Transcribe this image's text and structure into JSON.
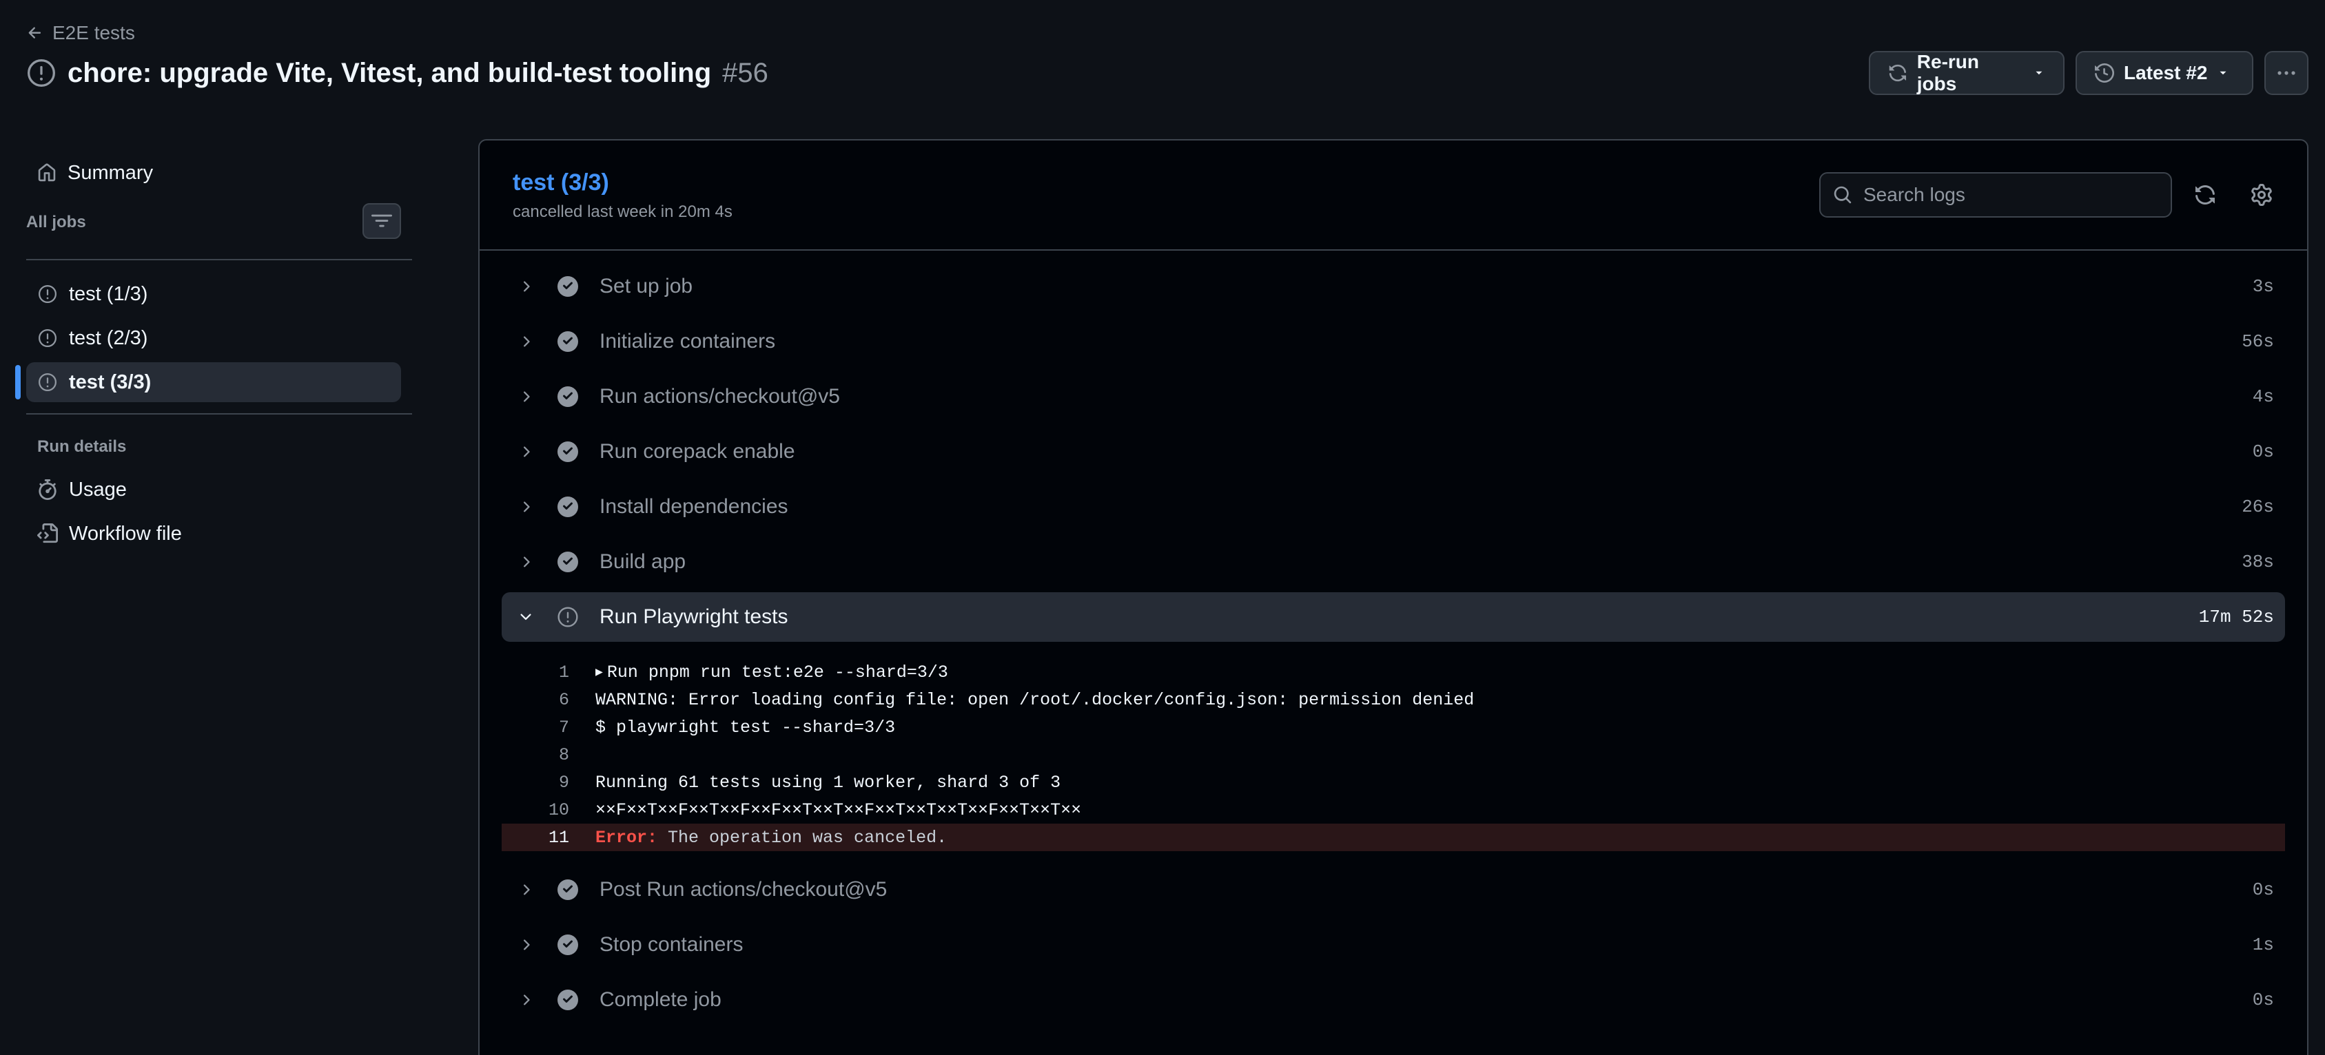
{
  "header": {
    "back_label": "E2E tests",
    "title": "chore: upgrade Vite, Vitest, and build-test tooling",
    "run_number": "#56",
    "rerun_label": "Re-run jobs",
    "attempt_label": "Latest #2"
  },
  "sidebar": {
    "summary_label": "Summary",
    "all_jobs_label": "All jobs",
    "jobs": [
      {
        "label": "test (1/3)"
      },
      {
        "label": "test (2/3)"
      },
      {
        "label": "test (3/3)",
        "active": true
      }
    ],
    "run_details_label": "Run details",
    "usage_label": "Usage",
    "workflow_file_label": "Workflow file"
  },
  "job": {
    "title": "test (3/3)",
    "subtitle": "cancelled last week in 20m 4s",
    "search_placeholder": "Search logs"
  },
  "steps": [
    {
      "name": "Set up job",
      "duration": "3s",
      "status": "success"
    },
    {
      "name": "Initialize containers",
      "duration": "56s",
      "status": "success"
    },
    {
      "name": "Run actions/checkout@v5",
      "duration": "4s",
      "status": "success"
    },
    {
      "name": "Run corepack enable",
      "duration": "0s",
      "status": "success"
    },
    {
      "name": "Install dependencies",
      "duration": "26s",
      "status": "success"
    },
    {
      "name": "Build app",
      "duration": "38s",
      "status": "success"
    },
    {
      "name": "Run Playwright tests",
      "duration": "17m 52s",
      "status": "cancelled",
      "expanded": true
    },
    {
      "name": "Post Run actions/checkout@v5",
      "duration": "0s",
      "status": "success"
    },
    {
      "name": "Stop containers",
      "duration": "1s",
      "status": "success"
    },
    {
      "name": "Complete job",
      "duration": "0s",
      "status": "success"
    }
  ],
  "log": [
    {
      "num": "1",
      "text": "Run pnpm run test:e2e --shard=3/3"
    },
    {
      "num": "6",
      "text": "WARNING: Error loading config file: open /root/.docker/config.json: permission denied"
    },
    {
      "num": "7",
      "text": "$ playwright test --shard=3/3"
    },
    {
      "num": "8",
      "text": ""
    },
    {
      "num": "9",
      "text": "Running 61 tests using 1 worker, shard 3 of 3"
    },
    {
      "num": "10",
      "text": "××F××T××F××T××F××F××T××T××F××T××T××T××F××T××T××"
    },
    {
      "num": "11",
      "error_label": "Error:",
      "text": "The operation was canceled."
    }
  ],
  "colors": {
    "background": "#0d1117",
    "panel": "#010409",
    "accent": "#4493f8",
    "error": "#f85149",
    "muted": "#9198a1"
  }
}
